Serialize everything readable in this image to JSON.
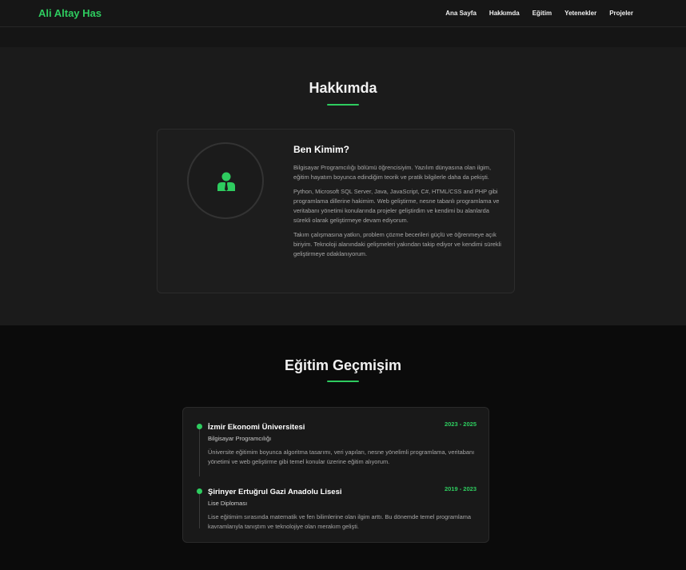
{
  "nav": {
    "brand": "Ali Altay Has",
    "links": [
      "Ana Sayfa",
      "Hakkımda",
      "Eğitim",
      "Yetenekler",
      "Projeler"
    ]
  },
  "about": {
    "title": "Hakkımda",
    "heading": "Ben Kimim?",
    "paragraphs": [
      "Bilgisayar Programcılığı bölümü öğrencisiyim. Yazılım dünyasına olan ilgim, eğitim hayatım boyunca edindiğim teorik ve pratik bilgilerle daha da pekişti.",
      "Python, Microsoft SQL Server, Java, JavaScript, C#, HTML/CSS and PHP gibi programlama dillerine hakimim. Web geliştirme, nesne tabanlı programlama ve veritabanı yönetimi konularında projeler geliştirdim ve kendimi bu alanlarda sürekli olarak geliştirmeye devam ediyorum.",
      "Takım çalışmasına yatkın, problem çözme becerileri güçlü ve öğrenmeye açık biriyim. Teknoloji alanındaki gelişmeleri yakından takip ediyor ve kendimi sürekli geliştirmeye odaklanıyorum."
    ]
  },
  "education": {
    "title": "Eğitim Geçmişim",
    "entries": [
      {
        "school": "İzmir Ekonomi Üniversitesi",
        "degree": "Bilgisayar Programcılığı",
        "years": "2023 - 2025",
        "description": "Üniversite eğitimim boyunca algoritma tasarımı, veri yapıları, nesne yönelimli programlama, veritabanı yönetimi ve web geliştirme gibi temel konular üzerine eğitim alıyorum."
      },
      {
        "school": "Şirinyer Ertuğrul Gazi Anadolu Lisesi",
        "degree": "Lise Diploması",
        "years": "2019 - 2023",
        "description": "Lise eğitimim sırasında matematik ve fen bilimlerine olan ilgim arttı. Bu dönemde temel programlama kavramlarıyla tanıştım ve teknolojiye olan merakım gelişti."
      }
    ]
  },
  "colors": {
    "accent": "#2ecc5f",
    "background": "#0a0a0a",
    "section_alt": "#1b1b1b"
  },
  "icons": {
    "avatar": "user-tie-icon"
  }
}
